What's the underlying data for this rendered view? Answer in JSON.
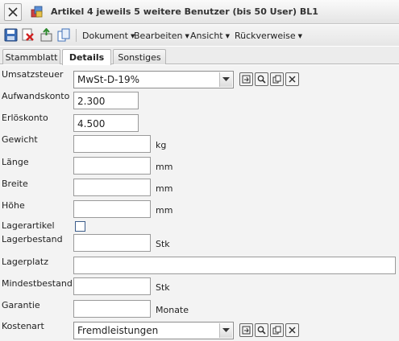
{
  "window": {
    "title": "Artikel 4 jeweils 5 weitere Benutzer (bis 50 User) BL1"
  },
  "toolbar": {
    "icons": [
      "save-icon",
      "delete-icon",
      "export-icon",
      "copy-icon"
    ],
    "menus": [
      "Dokument",
      "Bearbeiten",
      "Ansicht",
      "Rückverweise"
    ]
  },
  "tabs": [
    {
      "label": "Stammblatt",
      "active": false
    },
    {
      "label": "Details",
      "active": true
    },
    {
      "label": "Sonstiges",
      "active": false
    }
  ],
  "form": {
    "umsatzsteuer": {
      "label": "Umsatzsteuer",
      "value": "MwSt-D-19%"
    },
    "aufwandskonto": {
      "label": "Aufwandskonto",
      "value": "2.300"
    },
    "erloeskonto": {
      "label": "Erlöskonto",
      "value": "4.500"
    },
    "gewicht": {
      "label": "Gewicht",
      "value": "",
      "unit": "kg"
    },
    "laenge": {
      "label": "Länge",
      "value": "",
      "unit": "mm"
    },
    "breite": {
      "label": "Breite",
      "value": "",
      "unit": "mm"
    },
    "hoehe": {
      "label": "Höhe",
      "value": "",
      "unit": "mm"
    },
    "lagerartikel": {
      "label": "Lagerartikel",
      "checked": false
    },
    "lagerbestand": {
      "label": "Lagerbestand",
      "value": "",
      "unit": "Stk"
    },
    "lagerplatz": {
      "label": "Lagerplatz",
      "value": ""
    },
    "mindestbestand": {
      "label": "Mindestbestand",
      "value": "",
      "unit": "Stk"
    },
    "garantie": {
      "label": "Garantie",
      "value": "",
      "unit": "Monate"
    },
    "kostenart": {
      "label": "Kostenart",
      "value": "Fremdleistungen"
    }
  },
  "colors": {
    "accent": "#3c5c8a",
    "form_background": "#f3f3f3"
  }
}
